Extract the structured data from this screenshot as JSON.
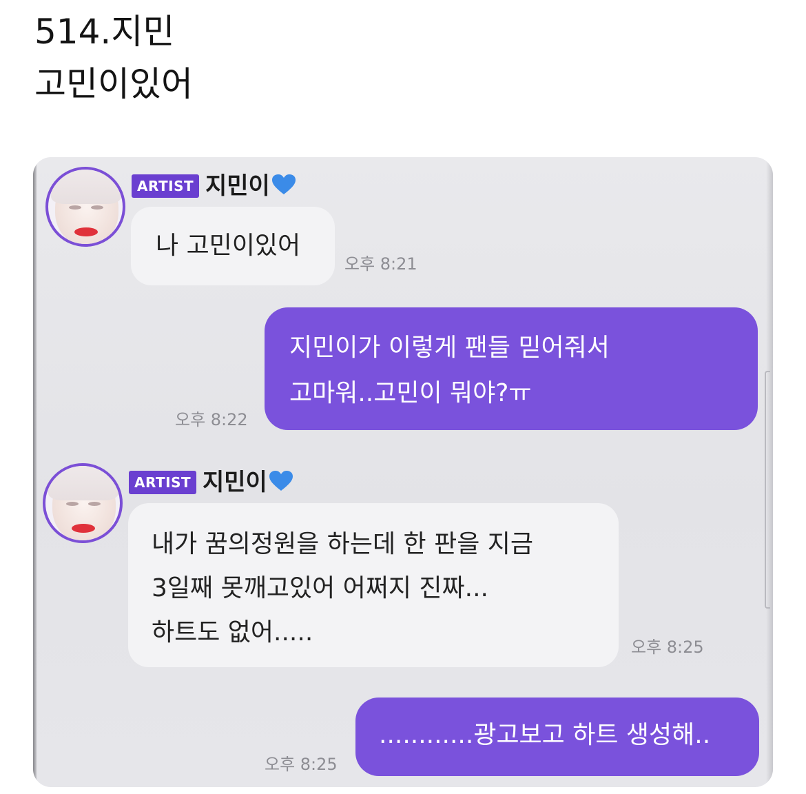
{
  "post": {
    "title": "514.지민",
    "subtitle": "고민이있어"
  },
  "colors": {
    "accent": "#7a52dc",
    "badge": "#6a3fd0",
    "heart": "#3b8be8",
    "incoming_bubble": "#f3f3f5",
    "chat_background": "#e6e6ea"
  },
  "chat": {
    "messages": [
      {
        "direction": "incoming",
        "badge": "ARTIST",
        "sender": "지민이",
        "sender_icon": "blue-heart-icon",
        "lines": [
          "나 고민이있어"
        ],
        "time": "오후 8:21"
      },
      {
        "direction": "outgoing",
        "lines": [
          "지민이가 이렇게 팬들 믿어줘서",
          "고마워..고민이 뭐야?ㅠ"
        ],
        "time": "오후 8:22"
      },
      {
        "direction": "incoming",
        "badge": "ARTIST",
        "sender": "지민이",
        "sender_icon": "blue-heart-icon",
        "lines": [
          "내가 꿈의정원을 하는데 한 판을 지금",
          "3일째 못깨고있어 어쩌지 진짜...",
          "하트도 없어....."
        ],
        "time": "오후 8:25"
      },
      {
        "direction": "outgoing",
        "lines": [
          "............광고보고 하트 생성해.."
        ],
        "time": "오후 8:25"
      }
    ]
  }
}
